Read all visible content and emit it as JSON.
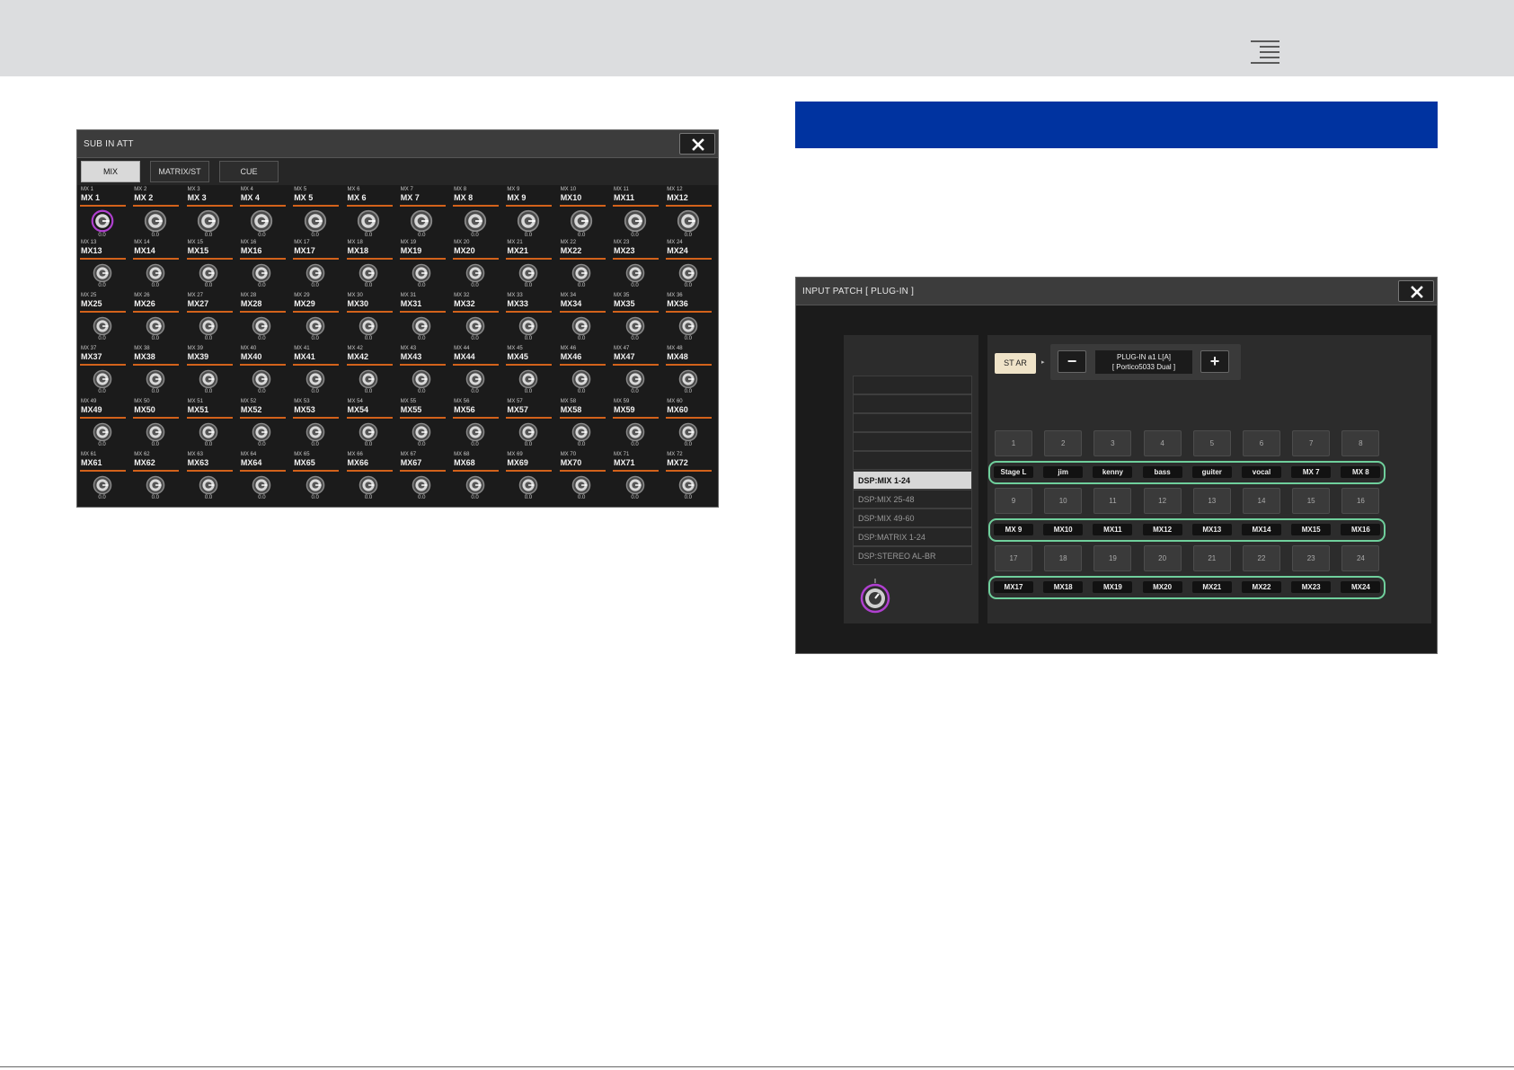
{
  "header": {
    "menu_icon": "hamburger-menu-icon"
  },
  "sub_in_att": {
    "title": "SUB IN ATT",
    "tabs": [
      "MIX",
      "MATRIX/ST",
      "CUE"
    ],
    "active_tab": "MIX",
    "channels": [
      {
        "ch": "MX 1",
        "name": "MX 1",
        "value": "0.0",
        "selected": true
      },
      {
        "ch": "MX 2",
        "name": "MX 2",
        "value": "0.0"
      },
      {
        "ch": "MX 3",
        "name": "MX 3",
        "value": "0.0"
      },
      {
        "ch": "MX 4",
        "name": "MX 4",
        "value": "0.0"
      },
      {
        "ch": "MX 5",
        "name": "MX 5",
        "value": "0.0"
      },
      {
        "ch": "MX 6",
        "name": "MX 6",
        "value": "0.0"
      },
      {
        "ch": "MX 7",
        "name": "MX 7",
        "value": "0.0"
      },
      {
        "ch": "MX 8",
        "name": "MX 8",
        "value": "0.0"
      },
      {
        "ch": "MX 9",
        "name": "MX 9",
        "value": "0.0"
      },
      {
        "ch": "MX 10",
        "name": "MX10",
        "value": "0.0"
      },
      {
        "ch": "MX 11",
        "name": "MX11",
        "value": "0.0"
      },
      {
        "ch": "MX 12",
        "name": "MX12",
        "value": "0.0"
      },
      {
        "ch": "MX 13",
        "name": "MX13",
        "value": "0.0"
      },
      {
        "ch": "MX 14",
        "name": "MX14",
        "value": "0.0"
      },
      {
        "ch": "MX 15",
        "name": "MX15",
        "value": "0.0"
      },
      {
        "ch": "MX 16",
        "name": "MX16",
        "value": "0.0"
      },
      {
        "ch": "MX 17",
        "name": "MX17",
        "value": "0.0"
      },
      {
        "ch": "MX 18",
        "name": "MX18",
        "value": "0.0"
      },
      {
        "ch": "MX 19",
        "name": "MX19",
        "value": "0.0"
      },
      {
        "ch": "MX 20",
        "name": "MX20",
        "value": "0.0"
      },
      {
        "ch": "MX 21",
        "name": "MX21",
        "value": "0.0"
      },
      {
        "ch": "MX 22",
        "name": "MX22",
        "value": "0.0"
      },
      {
        "ch": "MX 23",
        "name": "MX23",
        "value": "0.0"
      },
      {
        "ch": "MX 24",
        "name": "MX24",
        "value": "0.0"
      },
      {
        "ch": "MX 25",
        "name": "MX25",
        "value": "0.0"
      },
      {
        "ch": "MX 26",
        "name": "MX26",
        "value": "0.0"
      },
      {
        "ch": "MX 27",
        "name": "MX27",
        "value": "0.0"
      },
      {
        "ch": "MX 28",
        "name": "MX28",
        "value": "0.0"
      },
      {
        "ch": "MX 29",
        "name": "MX29",
        "value": "0.0"
      },
      {
        "ch": "MX 30",
        "name": "MX30",
        "value": "0.0"
      },
      {
        "ch": "MX 31",
        "name": "MX31",
        "value": "0.0"
      },
      {
        "ch": "MX 32",
        "name": "MX32",
        "value": "0.0"
      },
      {
        "ch": "MX 33",
        "name": "MX33",
        "value": "0.0"
      },
      {
        "ch": "MX 34",
        "name": "MX34",
        "value": "0.0"
      },
      {
        "ch": "MX 35",
        "name": "MX35",
        "value": "0.0"
      },
      {
        "ch": "MX 36",
        "name": "MX36",
        "value": "0.0"
      },
      {
        "ch": "MX 37",
        "name": "MX37",
        "value": "0.0"
      },
      {
        "ch": "MX 38",
        "name": "MX38",
        "value": "0.0"
      },
      {
        "ch": "MX 39",
        "name": "MX39",
        "value": "0.0"
      },
      {
        "ch": "MX 40",
        "name": "MX40",
        "value": "0.0"
      },
      {
        "ch": "MX 41",
        "name": "MX41",
        "value": "0.0"
      },
      {
        "ch": "MX 42",
        "name": "MX42",
        "value": "0.0"
      },
      {
        "ch": "MX 43",
        "name": "MX43",
        "value": "0.0"
      },
      {
        "ch": "MX 44",
        "name": "MX44",
        "value": "0.0"
      },
      {
        "ch": "MX 45",
        "name": "MX45",
        "value": "0.0"
      },
      {
        "ch": "MX 46",
        "name": "MX46",
        "value": "0.0"
      },
      {
        "ch": "MX 47",
        "name": "MX47",
        "value": "0.0"
      },
      {
        "ch": "MX 48",
        "name": "MX48",
        "value": "0.0"
      },
      {
        "ch": "MX 49",
        "name": "MX49",
        "value": "0.0"
      },
      {
        "ch": "MX 50",
        "name": "MX50",
        "value": "0.0"
      },
      {
        "ch": "MX 51",
        "name": "MX51",
        "value": "0.0"
      },
      {
        "ch": "MX 52",
        "name": "MX52",
        "value": "0.0"
      },
      {
        "ch": "MX 53",
        "name": "MX53",
        "value": "0.0"
      },
      {
        "ch": "MX 54",
        "name": "MX54",
        "value": "0.0"
      },
      {
        "ch": "MX 55",
        "name": "MX55",
        "value": "0.0"
      },
      {
        "ch": "MX 56",
        "name": "MX56",
        "value": "0.0"
      },
      {
        "ch": "MX 57",
        "name": "MX57",
        "value": "0.0"
      },
      {
        "ch": "MX 58",
        "name": "MX58",
        "value": "0.0"
      },
      {
        "ch": "MX 59",
        "name": "MX59",
        "value": "0.0"
      },
      {
        "ch": "MX 60",
        "name": "MX60",
        "value": "0.0"
      },
      {
        "ch": "MX 61",
        "name": "MX61",
        "value": "0.0"
      },
      {
        "ch": "MX 62",
        "name": "MX62",
        "value": "0.0"
      },
      {
        "ch": "MX 63",
        "name": "MX63",
        "value": "0.0"
      },
      {
        "ch": "MX 64",
        "name": "MX64",
        "value": "0.0"
      },
      {
        "ch": "MX 65",
        "name": "MX65",
        "value": "0.0"
      },
      {
        "ch": "MX 66",
        "name": "MX66",
        "value": "0.0"
      },
      {
        "ch": "MX 67",
        "name": "MX67",
        "value": "0.0"
      },
      {
        "ch": "MX 68",
        "name": "MX68",
        "value": "0.0"
      },
      {
        "ch": "MX 69",
        "name": "MX69",
        "value": "0.0"
      },
      {
        "ch": "MX 70",
        "name": "MX70",
        "value": "0.0"
      },
      {
        "ch": "MX 71",
        "name": "MX71",
        "value": "0.0"
      },
      {
        "ch": "MX 72",
        "name": "MX72",
        "value": "0.0"
      }
    ]
  },
  "input_patch": {
    "title": "INPUT PATCH  [ PLUG-IN ]",
    "categories": [
      {
        "label": ""
      },
      {
        "label": ""
      },
      {
        "label": ""
      },
      {
        "label": ""
      },
      {
        "label": ""
      },
      {
        "label": "DSP:MIX 1-24",
        "active": true
      },
      {
        "label": "DSP:MIX 25-48"
      },
      {
        "label": "DSP:MIX 49-60"
      },
      {
        "label": "DSP:MATRIX 1-24"
      },
      {
        "label": "DSP:STEREO AL-BR"
      }
    ],
    "st_button": "ST AR",
    "minus": "−",
    "plus": "+",
    "plugin_name_line1": "PLUG-IN a1 L[A]",
    "plugin_name_line2": "[ Portico5033 Dual ]",
    "ports": [
      {
        "num": "1",
        "label": "Stage L"
      },
      {
        "num": "2",
        "label": "jim"
      },
      {
        "num": "3",
        "label": "kenny"
      },
      {
        "num": "4",
        "label": "bass"
      },
      {
        "num": "5",
        "label": "guiter"
      },
      {
        "num": "6",
        "label": "vocal"
      },
      {
        "num": "7",
        "label": "MX 7"
      },
      {
        "num": "8",
        "label": "MX 8"
      },
      {
        "num": "9",
        "label": "MX 9"
      },
      {
        "num": "10",
        "label": "MX10"
      },
      {
        "num": "11",
        "label": "MX11"
      },
      {
        "num": "12",
        "label": "MX12"
      },
      {
        "num": "13",
        "label": "MX13"
      },
      {
        "num": "14",
        "label": "MX14"
      },
      {
        "num": "15",
        "label": "MX15"
      },
      {
        "num": "16",
        "label": "MX16"
      },
      {
        "num": "17",
        "label": "MX17"
      },
      {
        "num": "18",
        "label": "MX18"
      },
      {
        "num": "19",
        "label": "MX19"
      },
      {
        "num": "20",
        "label": "MX20"
      },
      {
        "num": "21",
        "label": "MX21"
      },
      {
        "num": "22",
        "label": "MX22"
      },
      {
        "num": "23",
        "label": "MX23"
      },
      {
        "num": "24",
        "label": "MX24"
      }
    ]
  },
  "colors": {
    "accent_blue": "#0033a0",
    "orange_line": "#d3621b",
    "highlight_green": "#6fcf9c",
    "knob_selected": "#b040d0"
  }
}
